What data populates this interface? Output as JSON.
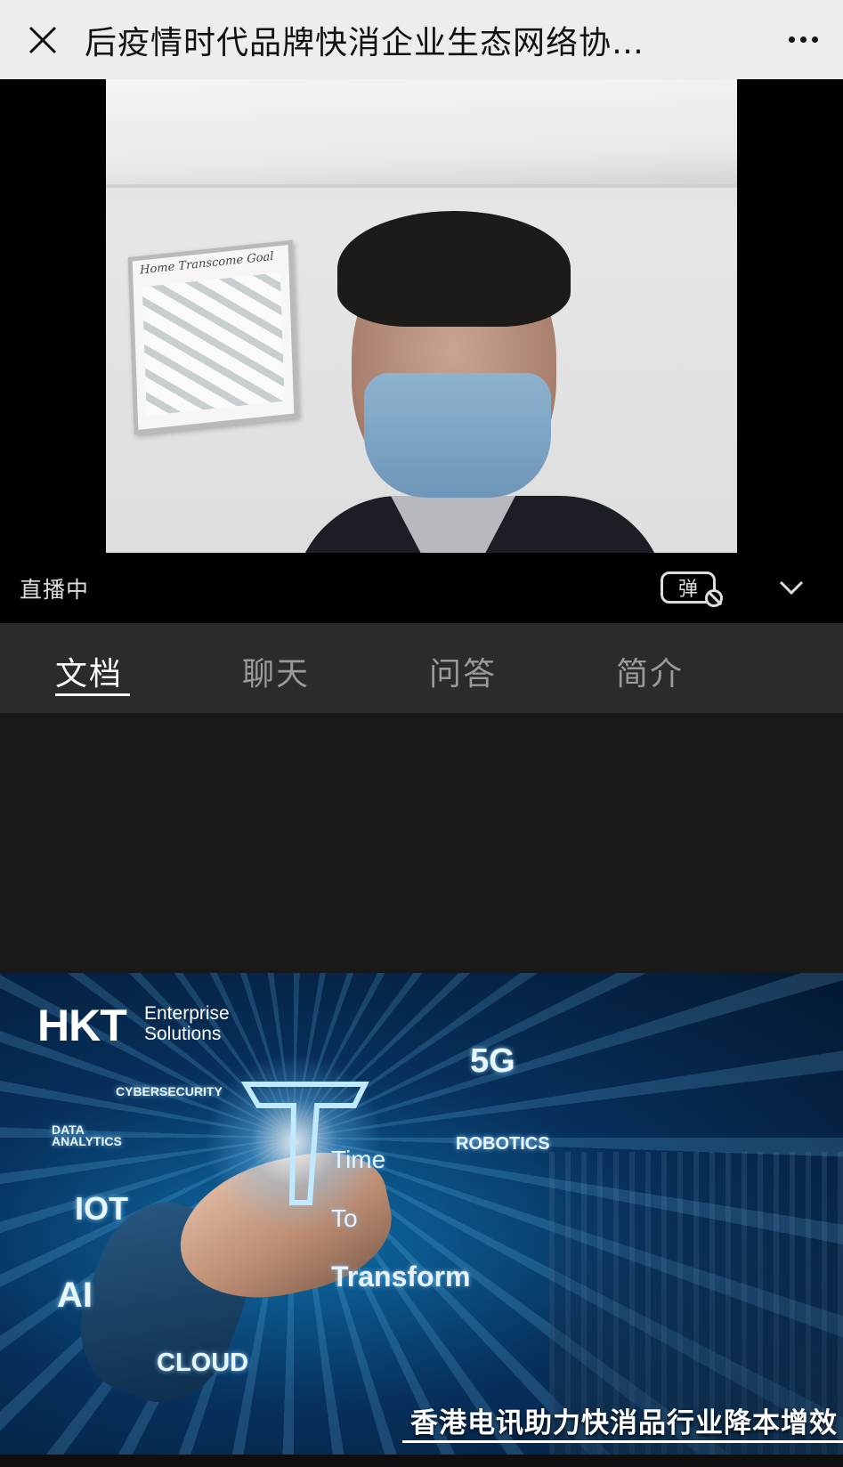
{
  "header": {
    "title": "后疫情时代品牌快消企业生态网络协…",
    "close_icon": "close-icon",
    "more_icon": "more-icon"
  },
  "player": {
    "status": "直播中",
    "danmaku_label": "弹",
    "danmaku_icon": "danmaku-off-icon",
    "collapse_icon": "chevron-down-icon",
    "poster_caption": "Home Transcome Goal"
  },
  "tabs": [
    {
      "label": "文档",
      "active": true
    },
    {
      "label": "聊天",
      "active": false
    },
    {
      "label": "问答",
      "active": false
    },
    {
      "label": "简介",
      "active": false
    }
  ],
  "slide": {
    "logo": "HKT",
    "logo_sub": "Enterprise\nSolutions",
    "tags": {
      "cybersecurity": "CYBERSECURITY",
      "data_analytics": "DATA\nANALYTICS",
      "iot": "IOT",
      "ai": "AI",
      "cloud": "CLOUD",
      "five_g": "5G",
      "robotics": "ROBOTICS"
    },
    "slogan": {
      "line1": "Time",
      "line2": "To",
      "line3": "Transform"
    },
    "caption": "香港电讯助力快消品行业降本增效"
  },
  "colors": {
    "title_bar": "#ededed",
    "tab_bar": "#2b2b2b",
    "doc_bg": "#191919",
    "slide_accent": "#0e6ea8"
  }
}
